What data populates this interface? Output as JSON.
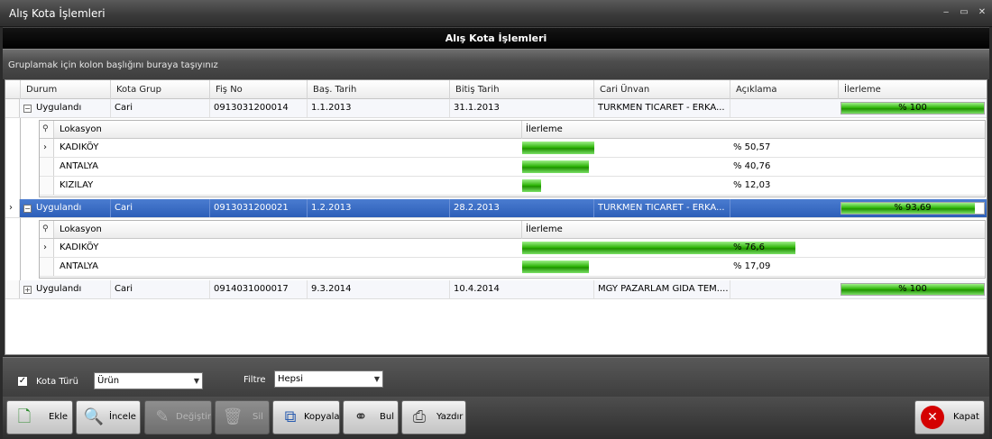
{
  "window": {
    "title": "Alış Kota İşlemleri",
    "header": "Alış Kota İşlemleri",
    "controls": [
      "‒",
      "▭",
      "✕"
    ]
  },
  "group_panel": {
    "hint": "Gruplamak için kolon başlığını buraya taşıyınız"
  },
  "grid": {
    "columns": [
      "Durum",
      "Kota Grup",
      "Fiş No",
      "Baş. Tarih",
      "Bitiş Tarih",
      "Cari Ünvan",
      "Açıklama",
      "İlerleme"
    ],
    "rows": [
      {
        "durum": "Uygulandı",
        "kota_grup": "Cari",
        "fis_no": "0913031200014",
        "bas_tarih": "1.1.2013",
        "bitis_tarih": "31.1.2013",
        "cari_unvan": "TURKMEN TICARET - ERKA...",
        "aciklama": "",
        "ilerleme_text": "% 100",
        "ilerleme": 100,
        "expanded": true,
        "details": {
          "columns": [
            "Lokasyon",
            "İlerleme"
          ],
          "rows": [
            {
              "lokasyon": "KADIKÖY",
              "ilerleme_text": "% 50,57",
              "ilerleme": 50.57
            },
            {
              "lokasyon": "ANTALYA",
              "ilerleme_text": "% 40,76",
              "ilerleme": 40.76
            },
            {
              "lokasyon": "KIZILAY",
              "ilerleme_text": "% 12,03",
              "ilerleme": 12.03
            }
          ]
        }
      },
      {
        "durum": "Uygulandı",
        "kota_grup": "Cari",
        "fis_no": "0913031200021",
        "bas_tarih": "1.2.2013",
        "bitis_tarih": "28.2.2013",
        "cari_unvan": "TURKMEN TICARET - ERKA...",
        "aciklama": "",
        "ilerleme_text": "% 93,69",
        "ilerleme": 93.69,
        "expanded": true,
        "selected": true,
        "details": {
          "columns": [
            "Lokasyon",
            "İlerleme"
          ],
          "rows": [
            {
              "lokasyon": "KADIKÖY",
              "ilerleme_text": "% 76,6",
              "ilerleme": 76.6
            },
            {
              "lokasyon": "ANTALYA",
              "ilerleme_text": "% 17,09",
              "ilerleme": 17.09
            }
          ]
        }
      },
      {
        "durum": "Uygulandı",
        "kota_grup": "Cari",
        "fis_no": "0914031000017",
        "bas_tarih": "9.3.2014",
        "bitis_tarih": "10.4.2014",
        "cari_unvan": "MGY PAZARLAM GIDA TEM....",
        "aciklama": "",
        "ilerleme_text": "% 100",
        "ilerleme": 100,
        "expanded": false
      }
    ]
  },
  "filters": {
    "kota_turu_label": "Kota Türü",
    "kota_turu_checked": true,
    "kota_turu_value": "Ürün",
    "filtre_label": "Filtre",
    "filtre_value": "Hepsi"
  },
  "toolbar": {
    "ekle": "Ekle",
    "incele": "İncele",
    "degistir": "Değiştir",
    "sil": "Sil",
    "kopyala": "Kopyala",
    "bul": "Bul",
    "yazdir": "Yazdır",
    "kapat": "Kapat"
  },
  "colors": {
    "selection": "#2d5fb8",
    "progress": "#27b000",
    "close_red": "#d40000"
  }
}
